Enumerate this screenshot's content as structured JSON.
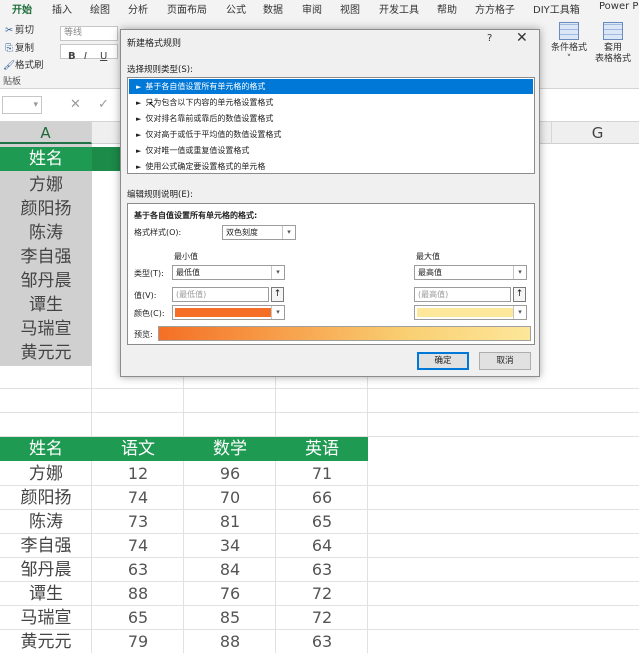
{
  "ribbon": {
    "tabs": [
      "开始",
      "插入",
      "绘图",
      "分析",
      "页面布局",
      "公式",
      "数据",
      "审阅",
      "视图",
      "开发工具",
      "帮助",
      "方方格子",
      "DIY工具箱",
      "Power Pi"
    ],
    "clipboard": {
      "cut": "剪切",
      "copy": "复制",
      "painter": "格式刷",
      "group": "贴板"
    },
    "font_name": "等线",
    "bold": "B",
    "italic": "I",
    "underline": "U",
    "cond_format": "条件格式",
    "table_format_line1": "套用",
    "table_format_line2": "表格格式"
  },
  "formula_bar": {
    "cancel": "✕",
    "enter": "✓"
  },
  "columns": [
    "A",
    "G"
  ],
  "upper_table": {
    "header": "姓名",
    "names": [
      "方娜",
      "颜阳扬",
      "陈涛",
      "李自强",
      "邹丹晨",
      "谭生",
      "马瑞宣",
      "黄元元"
    ]
  },
  "lower_table": {
    "headers": [
      "姓名",
      "语文",
      "数学",
      "英语"
    ],
    "rows": [
      [
        "方娜",
        "12",
        "96",
        "71"
      ],
      [
        "颜阳扬",
        "74",
        "70",
        "66"
      ],
      [
        "陈涛",
        "73",
        "81",
        "65"
      ],
      [
        "李自强",
        "74",
        "34",
        "64"
      ],
      [
        "邹丹晨",
        "63",
        "84",
        "63"
      ],
      [
        "谭生",
        "88",
        "76",
        "72"
      ],
      [
        "马瑞宣",
        "65",
        "85",
        "72"
      ],
      [
        "黄元元",
        "79",
        "88",
        "63"
      ]
    ]
  },
  "dialog": {
    "title": "新建格式规则",
    "help": "?",
    "close": "✕",
    "select_type_label": "选择规则类型(S):",
    "rule_types": [
      "基于各自值设置所有单元格的格式",
      "只为包含以下内容的单元格设置格式",
      "仅对排名靠前或靠后的数值设置格式",
      "仅对高于或低于平均值的数值设置格式",
      "仅对唯一值或重复值设置格式",
      "使用公式确定要设置格式的单元格"
    ],
    "edit_desc_label": "编辑规则说明(E):",
    "desc_heading": "基于各自值设置所有单元格的格式:",
    "format_style_label": "格式样式(O):",
    "format_style_value": "双色刻度",
    "min_heading": "最小值",
    "max_heading": "最大值",
    "type_label": "类型(T):",
    "value_label": "值(V):",
    "color_label": "颜色(C):",
    "min_type": "最低值",
    "max_type": "最高值",
    "min_value_placeholder": "(最低值)",
    "max_value_placeholder": "(最高值)",
    "min_color": "#f46f25",
    "max_color": "#fde79a",
    "preview_label": "预览:",
    "ok": "确定",
    "cancel": "取消"
  }
}
